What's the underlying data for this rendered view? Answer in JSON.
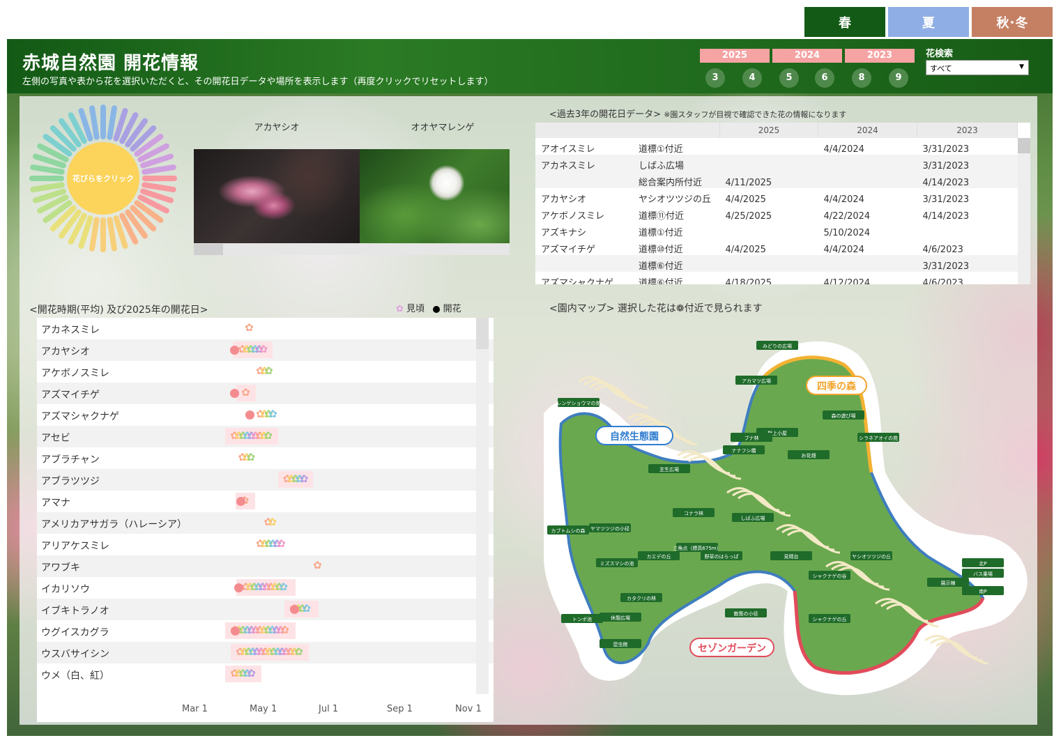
{
  "season_tabs": [
    {
      "label": "春",
      "color": "#135a16"
    },
    {
      "label": "夏",
      "color": "#8faee6"
    },
    {
      "label": "秋･冬",
      "color": "#c58064"
    }
  ],
  "header": {
    "title": "赤城自然園 開花情報",
    "subtitle": "左側の写真や表から花を選択いただくと、その開花日データや場所を表示します（再度クリックでリセットします）"
  },
  "years": [
    "2025",
    "2024",
    "2023"
  ],
  "months": [
    "3",
    "4",
    "5",
    "6",
    "8",
    "9"
  ],
  "search": {
    "label": "花検索",
    "value": "すべて"
  },
  "wheel": {
    "label": "花びらをクリック"
  },
  "photos": [
    {
      "caption": "アカヤシオ"
    },
    {
      "caption": "オオヤマレンゲ"
    }
  ],
  "table": {
    "title": "<過去3年の開花日データ>",
    "note": "※園スタッフが目視で確認できた花の情報になります",
    "years": [
      "2025",
      "2024",
      "2023"
    ],
    "rows": [
      {
        "flower": "アオイスミレ",
        "place": "道標①付近",
        "y2025": "",
        "y2024": "4/4/2024",
        "y2023": "3/31/2023"
      },
      {
        "flower": "アカネスミレ",
        "place": "しばふ広場",
        "y2025": "",
        "y2024": "",
        "y2023": "3/31/2023"
      },
      {
        "flower": "",
        "place": "総合案内所付近",
        "y2025": "4/11/2025",
        "y2024": "",
        "y2023": "4/14/2023"
      },
      {
        "flower": "アカヤシオ",
        "place": "ヤシオツツジの丘",
        "y2025": "4/4/2025",
        "y2024": "4/4/2024",
        "y2023": "3/31/2023"
      },
      {
        "flower": "アケボノスミレ",
        "place": "道標⑪付近",
        "y2025": "4/25/2025",
        "y2024": "4/22/2024",
        "y2023": "4/14/2023"
      },
      {
        "flower": "アズキナシ",
        "place": "道標①付近",
        "y2025": "",
        "y2024": "5/10/2024",
        "y2023": ""
      },
      {
        "flower": "アズマイチゲ",
        "place": "道標⑩付近",
        "y2025": "4/4/2025",
        "y2024": "4/4/2024",
        "y2023": "4/6/2023"
      },
      {
        "flower": "",
        "place": "道標⑥付近",
        "y2025": "",
        "y2024": "",
        "y2023": "3/31/2023"
      },
      {
        "flower": "アズマシャクナゲ",
        "place": "道標⑥付近",
        "y2025": "4/18/2025",
        "y2024": "4/12/2024",
        "y2023": "4/6/2023"
      }
    ]
  },
  "timeline": {
    "title": "<開花時期(平均) 及び2025年の開花日>",
    "legend_peak": "見頃",
    "legend_bloom": "開花",
    "axis": [
      "Mar 1",
      "May 1",
      "Jul 1",
      "Sep 1",
      "Nov 1"
    ]
  },
  "chart_data": {
    "type": "scatter",
    "x_axis": [
      "Mar 1",
      "May 1",
      "Jul 1",
      "Sep 1",
      "Nov 1"
    ],
    "series": [
      {
        "name": "見頃",
        "values": [
          {
            "flower": "アカネスミレ",
            "range": [
              "04/18",
              "04/18"
            ]
          },
          {
            "flower": "アカヤシオ",
            "range": [
              "04/12",
              "04/30"
            ]
          },
          {
            "flower": "アケボノスミレ",
            "range": [
              "04/28",
              "05/05"
            ]
          },
          {
            "flower": "アズマイチゲ",
            "range": [
              "04/15",
              "04/15"
            ]
          },
          {
            "flower": "アズマシャクナゲ",
            "range": [
              "04/28",
              "05/10"
            ]
          },
          {
            "flower": "アセビ",
            "range": [
              "04/05",
              "05/05"
            ]
          },
          {
            "flower": "アブラチャン",
            "range": [
              "04/12",
              "04/20"
            ]
          },
          {
            "flower": "アブラツツジ",
            "range": [
              "05/22",
              "06/05"
            ]
          },
          {
            "flower": "アマナ",
            "range": [
              "04/14",
              "04/14"
            ]
          },
          {
            "flower": "アメリカアサガラ（ハレーシア）",
            "range": [
              "05/05",
              "05/10"
            ]
          },
          {
            "flower": "アリアケスミレ",
            "range": [
              "04/28",
              "05/15"
            ]
          },
          {
            "flower": "アワブキ",
            "range": [
              "06/18",
              "06/18"
            ]
          },
          {
            "flower": "イカリソウ",
            "range": [
              "04/15",
              "05/20"
            ]
          },
          {
            "flower": "イブキトラノオ",
            "range": [
              "05/28",
              "06/10"
            ]
          },
          {
            "flower": "ウグイスカグラ",
            "range": [
              "04/05",
              "05/20"
            ]
          },
          {
            "flower": "ウスバサイシン",
            "range": [
              "04/10",
              "06/01"
            ]
          },
          {
            "flower": "ウメ（白、紅）",
            "range": [
              "04/05",
              "04/20"
            ]
          }
        ]
      },
      {
        "name": "開花",
        "values": [
          {
            "flower": "アカヤシオ",
            "date": "04/04"
          },
          {
            "flower": "アズマイチゲ",
            "date": "04/04"
          },
          {
            "flower": "アズマシャクナゲ",
            "date": "04/18"
          },
          {
            "flower": "アマナ",
            "date": "04/10"
          },
          {
            "flower": "イカリソウ",
            "date": "04/08"
          },
          {
            "flower": "イブキトラノオ",
            "date": "05/28"
          },
          {
            "flower": "ウグイスカグラ",
            "date": "04/05"
          }
        ]
      }
    ]
  },
  "map": {
    "title": "<園内マップ>",
    "note_pre": "選択した花は",
    "note_post": "付近で見られます",
    "areas": [
      "自然生態園",
      "四季の森",
      "セゾンガーデン"
    ],
    "places": [
      "みどりの広場",
      "アカマツ広場",
      "レンゲショウマの苑",
      "森の遊び場",
      "シラネアオイの苑",
      "樹上小屋",
      "ブナ林",
      "ナナフシ橋",
      "お花畑",
      "芝生広場",
      "しばふ広場",
      "コナラ林",
      "ヤマツツジの小径",
      "三角点（標高675m）",
      "カエデの丘",
      "カブトムシの森",
      "ミズスマシの池",
      "野草のはらっぱ",
      "見晴台",
      "ヤシオツツジの丘",
      "シャクナゲの谷",
      "シャクナゲの丘",
      "散策の小径",
      "カタクリの林",
      "休憩広場",
      "トンボ池",
      "昆虫館",
      "北P",
      "南P",
      "展示棟",
      "バス乗場"
    ]
  },
  "timeline_rows": [
    {
      "name": "アカネスミレ",
      "bar": false
    },
    {
      "name": "アカヤシオ",
      "bar": true
    },
    {
      "name": "アケボノスミレ",
      "bar": false
    },
    {
      "name": "アズマイチゲ",
      "bar": true
    },
    {
      "name": "アズマシャクナゲ",
      "bar": false
    },
    {
      "name": "アセビ",
      "bar": true
    },
    {
      "name": "アブラチャン",
      "bar": false
    },
    {
      "name": "アブラツツジ",
      "bar": true
    },
    {
      "name": "アマナ",
      "bar": true
    },
    {
      "name": "アメリカアサガラ（ハレーシア）",
      "bar": false
    },
    {
      "name": "アリアケスミレ",
      "bar": false
    },
    {
      "name": "アワブキ",
      "bar": false
    },
    {
      "name": "イカリソウ",
      "bar": true
    },
    {
      "name": "イブキトラノオ",
      "bar": true
    },
    {
      "name": "ウグイスカグラ",
      "bar": true
    },
    {
      "name": "ウスバサイシン",
      "bar": true
    },
    {
      "name": "ウメ（白、紅）",
      "bar": true
    }
  ]
}
